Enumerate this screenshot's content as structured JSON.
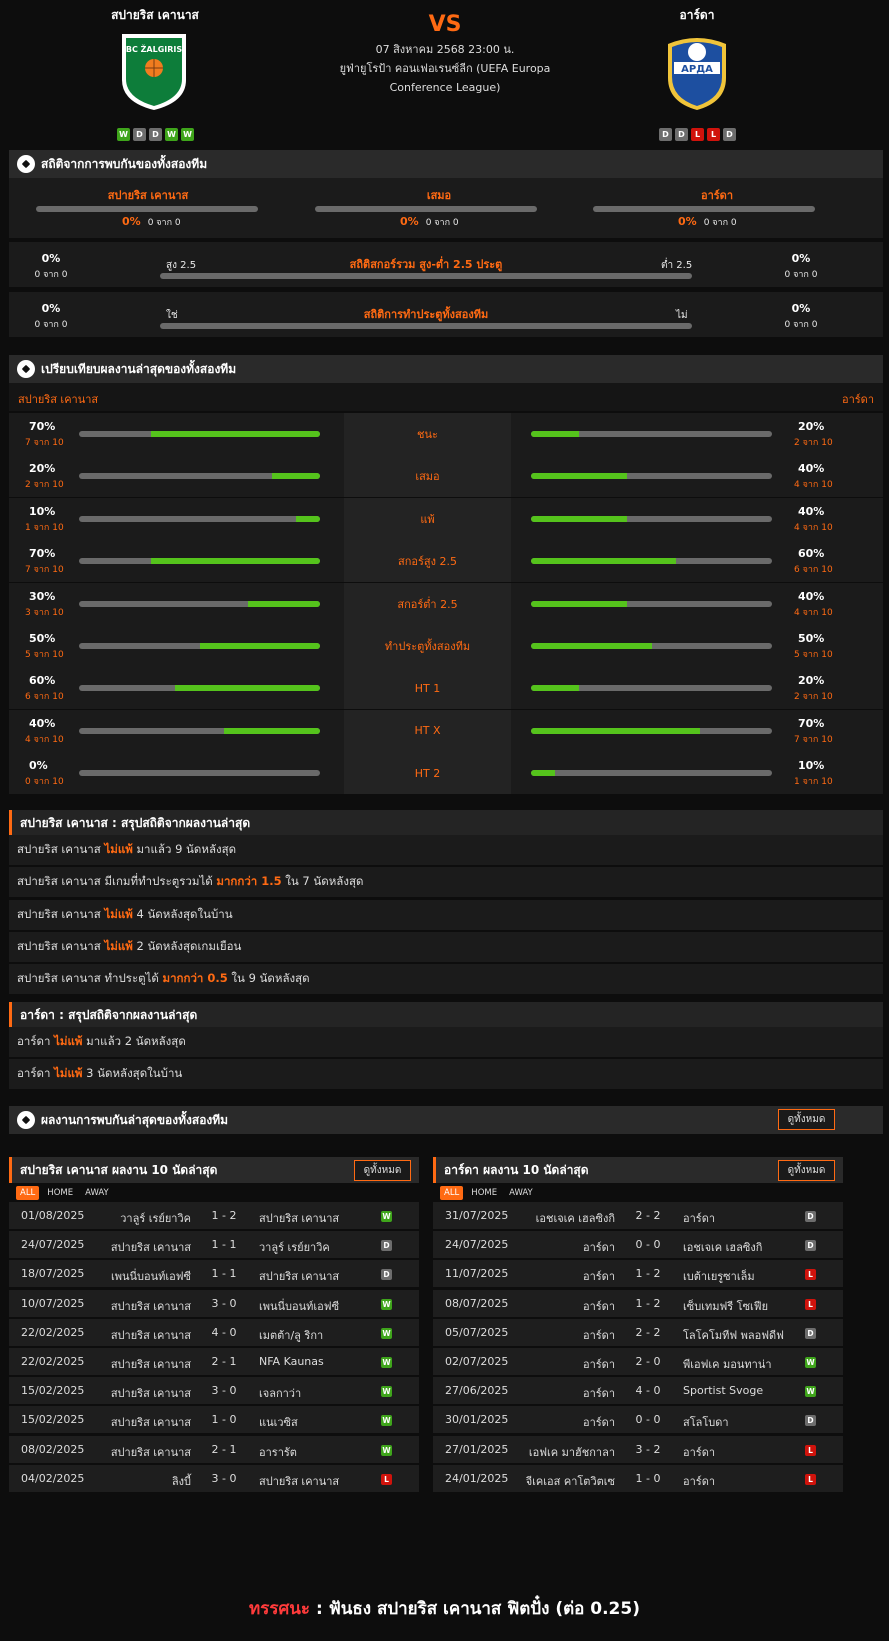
{
  "header": {
    "home_team": "สปายริส เคานาส",
    "away_team": "อาร์ดา",
    "vs": "VS",
    "date_time": "07 สิงหาคม 2568 23:00 น.",
    "competition": "ยูฟ่ายูโรป้า คอนเฟอเรนซ์ลีก (UEFA Europa Conference League)",
    "home_form": [
      "W",
      "D",
      "D",
      "W",
      "W"
    ],
    "away_form": [
      "D",
      "D",
      "L",
      "L",
      "D"
    ],
    "home_logo_text": "BC ŽALGIRIS",
    "away_logo_text": "АРДА"
  },
  "h2h": {
    "title": "สถิติจากการพบกันของทั้งสองทีม",
    "cols": [
      {
        "label": "สปายริส เคานาส",
        "pct": "0%",
        "count": "0 จาก 0"
      },
      {
        "label": "เสมอ",
        "pct": "0%",
        "count": "0 จาก 0"
      },
      {
        "label": "อาร์ดา",
        "pct": "0%",
        "count": "0 จาก 0"
      }
    ],
    "ou": {
      "title": "สถิติสกอร์รวม สูง-ต่ำ 2.5 ประตู",
      "left_label": "สูง 2.5",
      "right_label": "ต่ำ 2.5",
      "left_pct": "0%",
      "left_count": "0 จาก 0",
      "right_pct": "0%",
      "right_count": "0 จาก 0"
    },
    "btts": {
      "title": "สถิติการทำประตูทั้งสองทีม",
      "left_label": "ใช่",
      "right_label": "ไม่",
      "left_pct": "0%",
      "left_count": "0 จาก 0",
      "right_pct": "0%",
      "right_count": "0 จาก 0"
    }
  },
  "compare": {
    "title": "เปรียบเทียบผลงานล่าสุดของทั้งสองทีม",
    "home": "สปายริส เคานาส",
    "away": "อาร์ดา",
    "rows": [
      {
        "label": "ชนะ",
        "home_pct": "70%",
        "home_count": "7 จาก 10",
        "home_val": 0.7,
        "away_pct": "20%",
        "away_count": "2 จาก 10",
        "away_val": 0.2
      },
      {
        "label": "เสมอ",
        "home_pct": "20%",
        "home_count": "2 จาก 10",
        "home_val": 0.2,
        "away_pct": "40%",
        "away_count": "4 จาก 10",
        "away_val": 0.4
      },
      {
        "label": "แพ้",
        "home_pct": "10%",
        "home_count": "1 จาก 10",
        "home_val": 0.1,
        "away_pct": "40%",
        "away_count": "4 จาก 10",
        "away_val": 0.4
      },
      {
        "label": "สกอร์สูง 2.5",
        "home_pct": "70%",
        "home_count": "7 จาก 10",
        "home_val": 0.7,
        "away_pct": "60%",
        "away_count": "6 จาก 10",
        "away_val": 0.6
      },
      {
        "label": "สกอร์ต่ำ 2.5",
        "home_pct": "30%",
        "home_count": "3 จาก 10",
        "home_val": 0.3,
        "away_pct": "40%",
        "away_count": "4 จาก 10",
        "away_val": 0.4
      },
      {
        "label": "ทำประตูทั้งสองทีม",
        "home_pct": "50%",
        "home_count": "5 จาก 10",
        "home_val": 0.5,
        "away_pct": "50%",
        "away_count": "5 จาก 10",
        "away_val": 0.5
      },
      {
        "label": "HT 1",
        "home_pct": "60%",
        "home_count": "6 จาก 10",
        "home_val": 0.6,
        "away_pct": "20%",
        "away_count": "2 จาก 10",
        "away_val": 0.2
      },
      {
        "label": "HT X",
        "home_pct": "40%",
        "home_count": "4 จาก 10",
        "home_val": 0.4,
        "away_pct": "70%",
        "away_count": "7 จาก 10",
        "away_val": 0.7
      },
      {
        "label": "HT 2",
        "home_pct": "0%",
        "home_count": "0 จาก 10",
        "home_val": 0.0,
        "away_pct": "10%",
        "away_count": "1 จาก 10",
        "away_val": 0.1
      }
    ]
  },
  "home_summary": {
    "title": "สปายริส เคานาส : สรุปสถิติจากผลงานล่าสุด",
    "rows": [
      {
        "pre": "สปายริส เคานาส ",
        "hl": "ไม่แพ้",
        "post": " มาแล้ว 9 นัดหลังสุด"
      },
      {
        "pre": "สปายริส เคานาส มีเกมที่ทำประตูรวมได้ ",
        "hl": "มากกว่า 1.5",
        "post": " ใน 7 นัดหลังสุด"
      },
      {
        "pre": "สปายริส เคานาส ",
        "hl": "ไม่แพ้",
        "post": " 4 นัดหลังสุดในบ้าน"
      },
      {
        "pre": "สปายริส เคานาส ",
        "hl": "ไม่แพ้",
        "post": " 2 นัดหลังสุดเกมเยือน"
      },
      {
        "pre": "สปายริส เคานาส ทำประตูได้ ",
        "hl": "มากกว่า 0.5",
        "post": " ใน 9 นัดหลังสุด"
      }
    ]
  },
  "away_summary": {
    "title": "อาร์ดา : สรุปสถิติจากผลงานล่าสุด",
    "rows": [
      {
        "pre": "อาร์ดา ",
        "hl": "ไม่แพ้",
        "post": " มาแล้ว 2 นัดหลังสุด"
      },
      {
        "pre": "อาร์ดา ",
        "hl": "ไม่แพ้",
        "post": " 3 นัดหลังสุดในบ้าน"
      }
    ]
  },
  "recent": {
    "title": "ผลงานการพบกันล่าสุดของทั้งสองทีม",
    "view_all": "ดูทั้งหมด",
    "tabs": [
      "ALL",
      "HOME",
      "AWAY"
    ],
    "home_list": {
      "title": "สปายริส เคานาส ผลงาน 10 นัดล่าสุด",
      "matches": [
        {
          "date": "01/08/2025",
          "home": "วาลูร์ เรย์ยาวิค",
          "score": "1 - 2",
          "away": "สปายริส เคานาส",
          "res": "W"
        },
        {
          "date": "24/07/2025",
          "home": "สปายริส เคานาส",
          "score": "1 - 1",
          "away": "วาลูร์ เรย์ยาวิค",
          "res": "D"
        },
        {
          "date": "18/07/2025",
          "home": "เพนนี่บอนท์เอฟซี",
          "score": "1 - 1",
          "away": "สปายริส เคานาส",
          "res": "D"
        },
        {
          "date": "10/07/2025",
          "home": "สปายริส เคานาส",
          "score": "3 - 0",
          "away": "เพนนี่บอนท์เอฟซี",
          "res": "W"
        },
        {
          "date": "22/02/2025",
          "home": "สปายริส เคานาส",
          "score": "4 - 0",
          "away": "เมตต้า/ลู ริกา",
          "res": "W"
        },
        {
          "date": "22/02/2025",
          "home": "สปายริส เคานาส",
          "score": "2 - 1",
          "away": "NFA Kaunas",
          "res": "W"
        },
        {
          "date": "15/02/2025",
          "home": "สปายริส เคานาส",
          "score": "3 - 0",
          "away": "เจลกาว่า",
          "res": "W"
        },
        {
          "date": "15/02/2025",
          "home": "สปายริส เคานาส",
          "score": "1 - 0",
          "away": "แนเวซิส",
          "res": "W"
        },
        {
          "date": "08/02/2025",
          "home": "สปายริส เคานาส",
          "score": "2 - 1",
          "away": "อารารัต",
          "res": "W"
        },
        {
          "date": "04/02/2025",
          "home": "ลิงบี้",
          "score": "3 - 0",
          "away": "สปายริส เคานาส",
          "res": "L"
        }
      ]
    },
    "away_list": {
      "title": "อาร์ดา ผลงาน 10 นัดล่าสุด",
      "matches": [
        {
          "date": "31/07/2025",
          "home": "เอชเจเค เฮลซิงกิ",
          "score": "2 - 2",
          "away": "อาร์ดา",
          "res": "D"
        },
        {
          "date": "24/07/2025",
          "home": "อาร์ดา",
          "score": "0 - 0",
          "away": "เอชเจเค เฮลซิงกิ",
          "res": "D"
        },
        {
          "date": "11/07/2025",
          "home": "อาร์ดา",
          "score": "1 - 2",
          "away": "เบต้าเยรูซาเล็ม",
          "res": "L"
        },
        {
          "date": "08/07/2025",
          "home": "อาร์ดา",
          "score": "1 - 2",
          "away": "เซ็บเทมฟรี โซเฟีย",
          "res": "L"
        },
        {
          "date": "05/07/2025",
          "home": "อาร์ดา",
          "score": "2 - 2",
          "away": "โลโคโมทีฟ พลอฟดีฟ",
          "res": "D"
        },
        {
          "date": "02/07/2025",
          "home": "อาร์ดา",
          "score": "2 - 0",
          "away": "พีเอฟเค มอนทาน่า",
          "res": "W"
        },
        {
          "date": "27/06/2025",
          "home": "อาร์ดา",
          "score": "4 - 0",
          "away": "Sportist Svoge",
          "res": "W"
        },
        {
          "date": "30/01/2025",
          "home": "อาร์ดา",
          "score": "0 - 0",
          "away": "สโลโบดา",
          "res": "D"
        },
        {
          "date": "27/01/2025",
          "home": "เอฟเค มาฮัชกาลา",
          "score": "3 - 2",
          "away": "อาร์ดา",
          "res": "L"
        },
        {
          "date": "24/01/2025",
          "home": "จีเคเอส คาโตวิตเซ",
          "score": "1 - 0",
          "away": "อาร์ดา",
          "res": "L"
        }
      ]
    }
  },
  "prediction": {
    "label": "ทรรศนะ",
    "sep": ":",
    "text": "ฟันธง สปายริส เคานาส ฟิตปั๋ง (ต่อ 0.25)"
  },
  "colors": {
    "accent": "#ff6a13",
    "bar_fill": "#55c31c",
    "win": "#3fa51b",
    "draw": "#6d6d6d",
    "loss": "#d0130c"
  }
}
